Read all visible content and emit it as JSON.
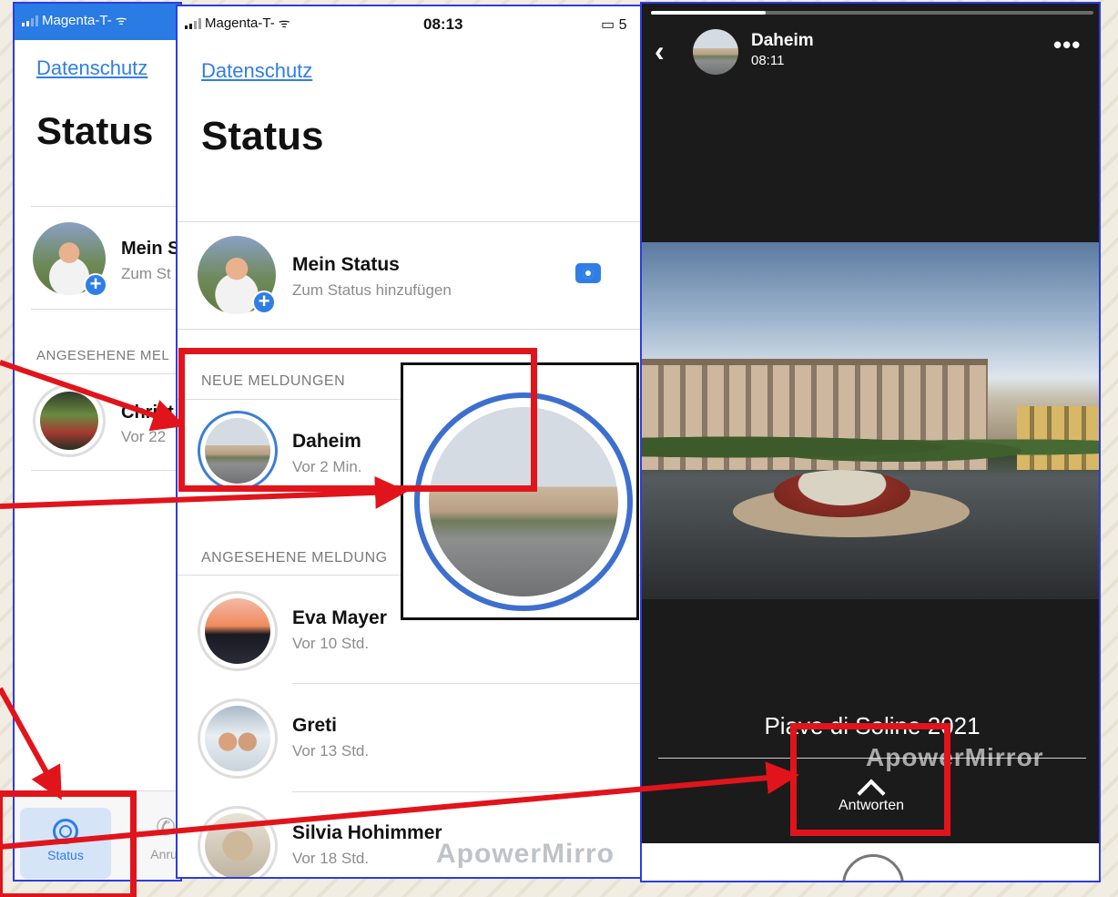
{
  "left_phone": {
    "status_bar": {
      "carrier": "Magenta-T-"
    },
    "privacy_link": "Datenschutz",
    "title": "Status",
    "my_status": {
      "name": "Mein S",
      "subtitle": "Zum St"
    },
    "section_viewed": "ANGESEHENE MEL",
    "contact": {
      "name": "Christ",
      "subtitle": "Vor 22"
    },
    "tabbar": {
      "status_label": "Status",
      "calls_label": "Anruf"
    }
  },
  "middle_phone": {
    "status_bar": {
      "carrier": "Magenta-T-",
      "time": "08:13",
      "battery": "5"
    },
    "privacy_link": "Datenschutz",
    "title": "Status",
    "my_status": {
      "name": "Mein Status",
      "subtitle": "Zum Status hinzufügen"
    },
    "section_new": "NEUE MELDUNGEN",
    "new_updates": [
      {
        "name": "Daheim",
        "subtitle": "Vor 2 Min."
      }
    ],
    "section_viewed": "ANGESEHENE MELDUNG",
    "viewed_updates": [
      {
        "name": "Eva Mayer",
        "subtitle": "Vor 10 Std."
      },
      {
        "name": "Greti",
        "subtitle": "Vor 13 Std."
      },
      {
        "name": "Silvia Hohimmer",
        "subtitle": "Vor 18 Std."
      }
    ],
    "watermark": "ApowerMirro"
  },
  "story_viewer": {
    "contact_name": "Daheim",
    "time": "08:11",
    "progress": 0.26,
    "caption": "Piave di Soline 2021",
    "watermark": "ApowerMirror",
    "reply_label": "Antworten"
  },
  "colors": {
    "accent": "#2f7ee6",
    "annotation": "#e1141b",
    "frame": "#2b3de0"
  }
}
